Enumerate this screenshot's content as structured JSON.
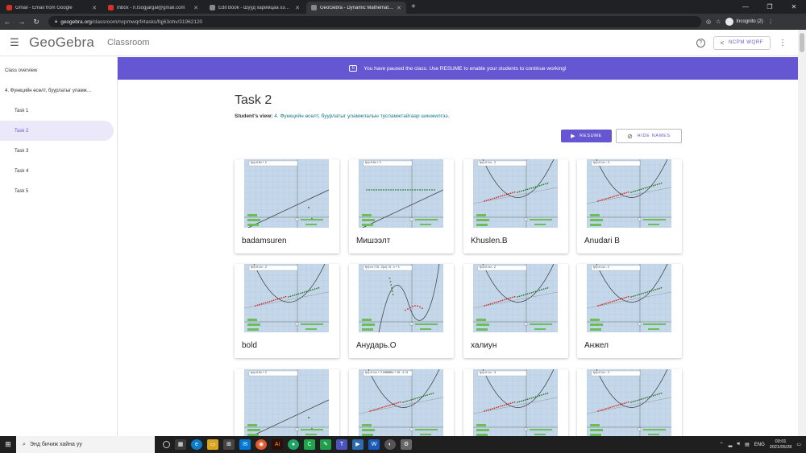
{
  "browser": {
    "tabs": [
      {
        "title": "Gmail - Email from Google",
        "fav": "#d93025",
        "active": false
      },
      {
        "title": "Inbox - n.tsogjargal@gmail.com",
        "fav": "#d93025",
        "active": false
      },
      {
        "title": "Edit Book - Шууд харимцаа хэлх…",
        "fav": "#888888",
        "active": false
      },
      {
        "title": "GeoGebra - Dynamic Mathemati…",
        "fav": "#888888",
        "active": true
      }
    ],
    "url_domain": "geogebra.org",
    "url_path": "/classroom/ncpmwqrf#tasks/fqj63ohv/31962120",
    "incognito_label": "Incognito (2)"
  },
  "header": {
    "logo": "GeoGebra",
    "section": "Classroom",
    "share_label": "NCPM WQRF"
  },
  "sidebar": {
    "overview": "Class overview",
    "group": "4. Функцийн өсөлт, буурлатыг уламж…",
    "tasks": [
      "Task 1",
      "Task 2",
      "Task 3",
      "Task 4",
      "Task 5"
    ],
    "active_index": 1
  },
  "banner": {
    "text": "You have paused the class. Use RESUME to enable your students to continue working!"
  },
  "main": {
    "title": "Task 2",
    "students_view_label": "Student's view:",
    "students_view_link": "4. Функцийн өсөлт, буурлатыг уламжлалын тусламжтайгаар шинжилгээ.",
    "resume_label": "RESUME",
    "hide_names_label": "HIDE NAMES"
  },
  "students": [
    {
      "name": "badamsuren",
      "input": "f(x)=0.5x + 2",
      "graph": "line"
    },
    {
      "name": "Мишээлт",
      "input": "f(x)=0.5x + 2",
      "graph": "line-dots"
    },
    {
      "name": "Khuslen.B",
      "input": "f(x)=0.1x² - 2",
      "graph": "parabola"
    },
    {
      "name": "Anudari B",
      "input": "f(x)=0.1x² - 2",
      "graph": "parabola"
    },
    {
      "name": "bold",
      "input": "f(x)=0.1x² - 2",
      "graph": "parabola"
    },
    {
      "name": "Анударь.О",
      "input": "f(x)=x³ / 15 - 2(x²) / 5 - x + 1",
      "graph": "cubic"
    },
    {
      "name": "халиун",
      "input": "f(x)=0.1x² - 2",
      "graph": "parabola"
    },
    {
      "name": "Анжел",
      "input": "f(x)=0.1x² - 2",
      "graph": "parabola"
    },
    {
      "name": "",
      "input": "f(x)=0.5x + 2",
      "graph": "line"
    },
    {
      "name": "",
      "input": "f(x)=0.1x² + 2.008889x + 15 - 4 / 5",
      "graph": "parabola"
    },
    {
      "name": "",
      "input": "f(x)=0.1x² - 3",
      "graph": "parabola"
    },
    {
      "name": "",
      "input": "f(x)=0.1x² - 2",
      "graph": "parabola"
    }
  ],
  "taskbar": {
    "search_placeholder": "Энд бичиж хайна уу",
    "lang": "ENG",
    "time": "00:01",
    "date": "2021/05/28"
  }
}
